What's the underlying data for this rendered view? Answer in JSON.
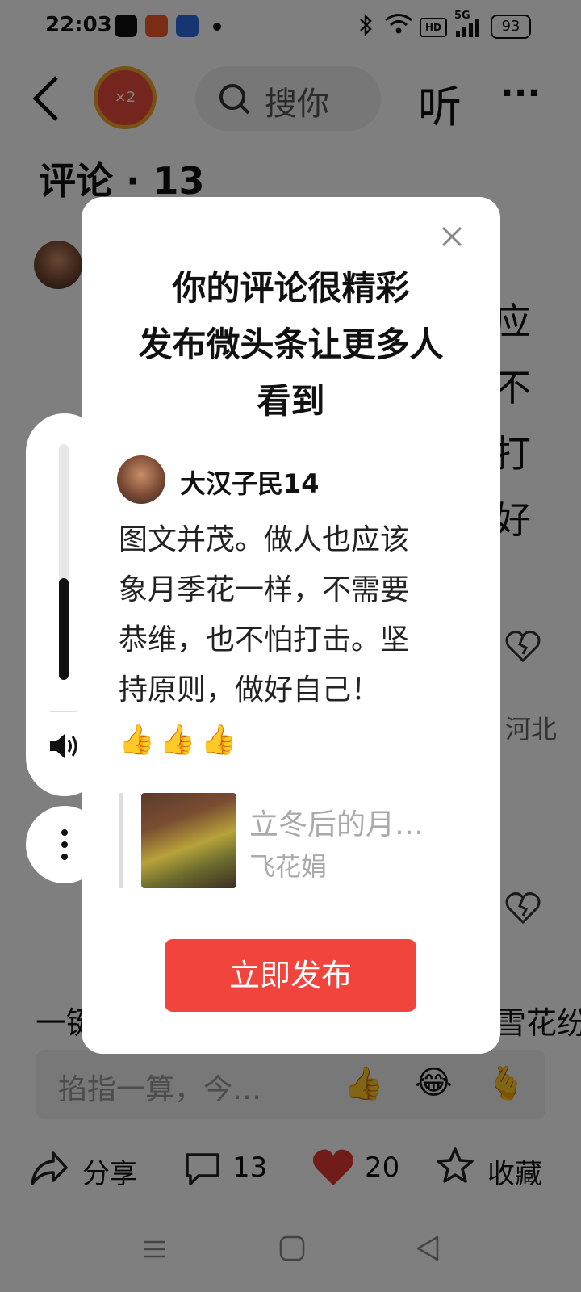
{
  "status": {
    "time": "22:03",
    "battery": "93",
    "network": "5G"
  },
  "header": {
    "search_placeholder": "搜你",
    "listen_label": "听",
    "more_label": "···",
    "badge": "×2"
  },
  "comments_title": "评论 · 13",
  "background_fragments": {
    "right_chars": [
      "应",
      "不",
      "打",
      "好"
    ],
    "location": "河北",
    "left_line": "一键",
    "right_line": "雪花纷"
  },
  "comment_input": {
    "placeholder": "掐指一算，今…",
    "emojis": [
      "👍",
      "😂",
      "🫰"
    ]
  },
  "modal": {
    "title_lines": [
      "你的评论很精彩",
      "发布微头条让更多人",
      "看到"
    ],
    "author": "大汉子民14",
    "comment_lines": [
      "图文并茂。做人也应该",
      "象月季花一样，不需要",
      "恭维，也不怕打击。坚",
      "持原则，做好自己！"
    ],
    "thumbs": "👍👍👍",
    "quote_title": "立冬后的月…",
    "quote_author": "飞花娟",
    "publish_label": "立即发布"
  },
  "volume": {
    "level": 0.43
  },
  "bottom_bar": {
    "share": "分享",
    "comments": "13",
    "likes": "20",
    "favorite": "收藏"
  },
  "colors": {
    "accent": "#f0443d",
    "like": "#e53935"
  }
}
